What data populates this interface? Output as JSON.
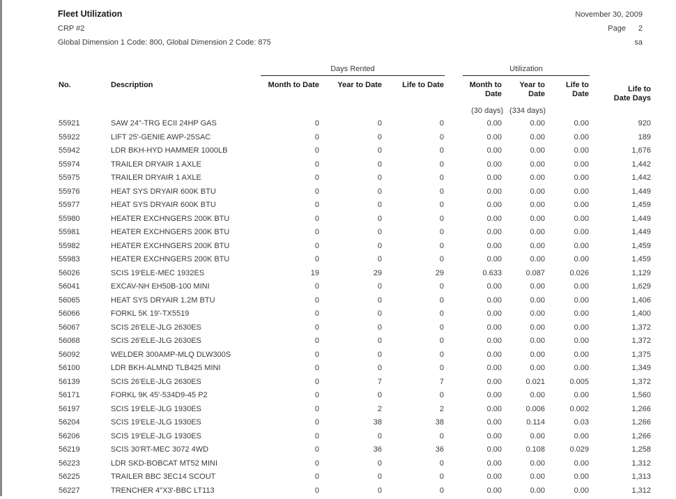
{
  "report": {
    "title": "Fleet Utilization",
    "subtitle": "CRP #2",
    "filter": "Global Dimension 1 Code: 800, Global Dimension 2 Code: 875",
    "date": "November 30, 2009",
    "page_label": "Page",
    "page_number": "2",
    "user": "sa"
  },
  "header": {
    "group_days_rented": "Days Rented",
    "group_utilization": "Utilization",
    "no": "No.",
    "description": "Description",
    "month_to_date": "Month to Date",
    "year_to_date": "Year to Date",
    "life_to_date": "Life to Date",
    "util_month_to_date_1": "Month to",
    "util_month_to_date_2": "Date",
    "util_year_to_date_1": "Year to",
    "util_year_to_date_2": "Date",
    "util_life_to_date_1": "Life to",
    "util_life_to_date_2": "Date",
    "life_to_date_days_1": "Life to",
    "life_to_date_days_2": "Date Days",
    "note_month": "(30 days)",
    "note_year": "(334 days)"
  },
  "rows": [
    {
      "no": "55921",
      "desc": "SAW 24\"-TRG ECII 24HP GAS",
      "mtd": "0",
      "ytd": "0",
      "ltd": "0",
      "umtd": "0.00",
      "uytd": "0.00",
      "ultd": "0.00",
      "days": "920"
    },
    {
      "no": "55922",
      "desc": "LIFT 25'-GENIE AWP-25SAC",
      "mtd": "0",
      "ytd": "0",
      "ltd": "0",
      "umtd": "0.00",
      "uytd": "0.00",
      "ultd": "0.00",
      "days": "189"
    },
    {
      "no": "55942",
      "desc": "LDR BKH-HYD HAMMER 1000LB",
      "mtd": "0",
      "ytd": "0",
      "ltd": "0",
      "umtd": "0.00",
      "uytd": "0.00",
      "ultd": "0.00",
      "days": "1,676"
    },
    {
      "no": "55974",
      "desc": "TRAILER DRYAIR 1 AXLE",
      "mtd": "0",
      "ytd": "0",
      "ltd": "0",
      "umtd": "0.00",
      "uytd": "0.00",
      "ultd": "0.00",
      "days": "1,442"
    },
    {
      "no": "55975",
      "desc": "TRAILER DRYAIR 1 AXLE",
      "mtd": "0",
      "ytd": "0",
      "ltd": "0",
      "umtd": "0.00",
      "uytd": "0.00",
      "ultd": "0.00",
      "days": "1,442"
    },
    {
      "no": "55976",
      "desc": "HEAT SYS DRYAIR 600K BTU",
      "mtd": "0",
      "ytd": "0",
      "ltd": "0",
      "umtd": "0.00",
      "uytd": "0.00",
      "ultd": "0.00",
      "days": "1,449"
    },
    {
      "no": "55977",
      "desc": "HEAT SYS DRYAIR 600K BTU",
      "mtd": "0",
      "ytd": "0",
      "ltd": "0",
      "umtd": "0.00",
      "uytd": "0.00",
      "ultd": "0.00",
      "days": "1,459"
    },
    {
      "no": "55980",
      "desc": "HEATER EXCHNGERS 200K BTU",
      "mtd": "0",
      "ytd": "0",
      "ltd": "0",
      "umtd": "0.00",
      "uytd": "0.00",
      "ultd": "0.00",
      "days": "1,449"
    },
    {
      "no": "55981",
      "desc": "HEATER EXCHNGERS 200K BTU",
      "mtd": "0",
      "ytd": "0",
      "ltd": "0",
      "umtd": "0.00",
      "uytd": "0.00",
      "ultd": "0.00",
      "days": "1,449"
    },
    {
      "no": "55982",
      "desc": "HEATER EXCHNGERS 200K BTU",
      "mtd": "0",
      "ytd": "0",
      "ltd": "0",
      "umtd": "0.00",
      "uytd": "0.00",
      "ultd": "0.00",
      "days": "1,459"
    },
    {
      "no": "55983",
      "desc": "HEATER EXCHNGERS 200K BTU",
      "mtd": "0",
      "ytd": "0",
      "ltd": "0",
      "umtd": "0.00",
      "uytd": "0.00",
      "ultd": "0.00",
      "days": "1,459"
    },
    {
      "no": "56026",
      "desc": "SCIS 19'ELE-MEC 1932ES",
      "mtd": "19",
      "ytd": "29",
      "ltd": "29",
      "umtd": "0.633",
      "uytd": "0.087",
      "ultd": "0.026",
      "days": "1,129"
    },
    {
      "no": "56041",
      "desc": "EXCAV-NH EH50B-100 MINI",
      "mtd": "0",
      "ytd": "0",
      "ltd": "0",
      "umtd": "0.00",
      "uytd": "0.00",
      "ultd": "0.00",
      "days": "1,629"
    },
    {
      "no": "56065",
      "desc": "HEAT SYS DRYAIR 1.2M BTU",
      "mtd": "0",
      "ytd": "0",
      "ltd": "0",
      "umtd": "0.00",
      "uytd": "0.00",
      "ultd": "0.00",
      "days": "1,406"
    },
    {
      "no": "56066",
      "desc": "FORKL  5K 19'-TX5519",
      "mtd": "0",
      "ytd": "0",
      "ltd": "0",
      "umtd": "0.00",
      "uytd": "0.00",
      "ultd": "0.00",
      "days": "1,400"
    },
    {
      "no": "56067",
      "desc": "SCIS 26'ELE-JLG 2630ES",
      "mtd": "0",
      "ytd": "0",
      "ltd": "0",
      "umtd": "0.00",
      "uytd": "0.00",
      "ultd": "0.00",
      "days": "1,372"
    },
    {
      "no": "56068",
      "desc": "SCIS 26'ELE-JLG 2630ES",
      "mtd": "0",
      "ytd": "0",
      "ltd": "0",
      "umtd": "0.00",
      "uytd": "0.00",
      "ultd": "0.00",
      "days": "1,372"
    },
    {
      "no": "56092",
      "desc": "WELDER 300AMP-MLQ DLW300S",
      "mtd": "0",
      "ytd": "0",
      "ltd": "0",
      "umtd": "0.00",
      "uytd": "0.00",
      "ultd": "0.00",
      "days": "1,375"
    },
    {
      "no": "56100",
      "desc": "LDR BKH-ALMND TLB425 MINI",
      "mtd": "0",
      "ytd": "0",
      "ltd": "0",
      "umtd": "0.00",
      "uytd": "0.00",
      "ultd": "0.00",
      "days": "1,349"
    },
    {
      "no": "56139",
      "desc": "SCIS 26'ELE-JLG 2630ES",
      "mtd": "0",
      "ytd": "7",
      "ltd": "7",
      "umtd": "0.00",
      "uytd": "0.021",
      "ultd": "0.005",
      "days": "1,372"
    },
    {
      "no": "56171",
      "desc": "FORKL  9K 45'-534D9-45 P2",
      "mtd": "0",
      "ytd": "0",
      "ltd": "0",
      "umtd": "0.00",
      "uytd": "0.00",
      "ultd": "0.00",
      "days": "1,560"
    },
    {
      "no": "56197",
      "desc": "SCIS 19'ELE-JLG 1930ES",
      "mtd": "0",
      "ytd": "2",
      "ltd": "2",
      "umtd": "0.00",
      "uytd": "0.006",
      "ultd": "0.002",
      "days": "1,266"
    },
    {
      "no": "56204",
      "desc": "SCIS 19'ELE-JLG 1930ES",
      "mtd": "0",
      "ytd": "38",
      "ltd": "38",
      "umtd": "0.00",
      "uytd": "0.114",
      "ultd": "0.03",
      "days": "1,266"
    },
    {
      "no": "56206",
      "desc": "SCIS 19'ELE-JLG 1930ES",
      "mtd": "0",
      "ytd": "0",
      "ltd": "0",
      "umtd": "0.00",
      "uytd": "0.00",
      "ultd": "0.00",
      "days": "1,266"
    },
    {
      "no": "56219",
      "desc": "SCIS 30'RT-MEC 3072 4WD",
      "mtd": "0",
      "ytd": "36",
      "ltd": "36",
      "umtd": "0.00",
      "uytd": "0.108",
      "ultd": "0.029",
      "days": "1,258"
    },
    {
      "no": "56223",
      "desc": "LDR SKD-BOBCAT MT52 MINI",
      "mtd": "0",
      "ytd": "0",
      "ltd": "0",
      "umtd": "0.00",
      "uytd": "0.00",
      "ultd": "0.00",
      "days": "1,312"
    },
    {
      "no": "56225",
      "desc": "TRAILER BBC 3EC14 SCOUT",
      "mtd": "0",
      "ytd": "0",
      "ltd": "0",
      "umtd": "0.00",
      "uytd": "0.00",
      "ultd": "0.00",
      "days": "1,313"
    },
    {
      "no": "56227",
      "desc": "TRENCHER 4\"X3'-BBC LT113",
      "mtd": "0",
      "ytd": "0",
      "ltd": "0",
      "umtd": "0.00",
      "uytd": "0.00",
      "ultd": "0.00",
      "days": "1,312"
    }
  ]
}
